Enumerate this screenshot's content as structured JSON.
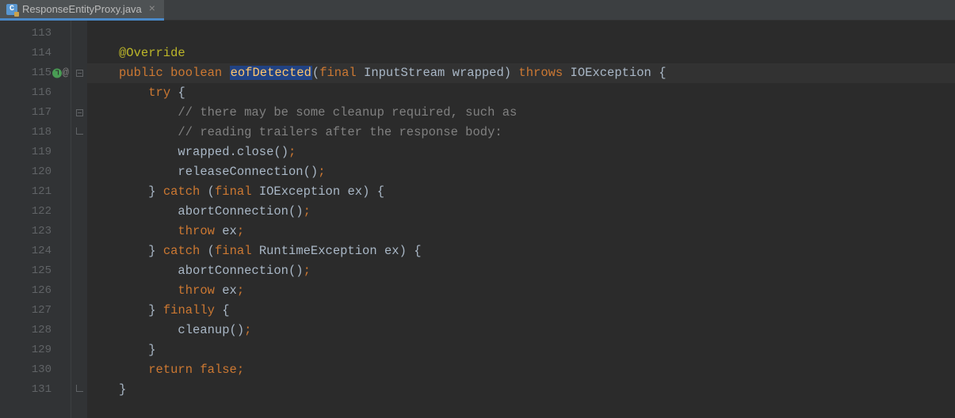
{
  "tab": {
    "icon_letter": "C",
    "filename": "ResponseEntityProxy.java",
    "close_symbol": "×"
  },
  "gutter": {
    "line_numbers": [
      "113",
      "114",
      "115",
      "116",
      "117",
      "118",
      "119",
      "120",
      "121",
      "122",
      "123",
      "124",
      "125",
      "126",
      "127",
      "128",
      "129",
      "130",
      "131"
    ],
    "impl_marker_line": "115",
    "at_symbol": "@"
  },
  "code": {
    "annotation_override": "@Override",
    "kw_public": "public",
    "kw_boolean": "boolean",
    "method_name": "eofDetected",
    "kw_final": "final",
    "type_inputstream": "InputStream",
    "var_wrapped": "wrapped",
    "kw_throws": "throws",
    "type_ioexception": "IOException",
    "brace_open": "{",
    "brace_close": "}",
    "kw_try": "try",
    "comment1": "// there may be some cleanup required, such as",
    "comment2": "// reading trailers after the response body:",
    "call_wrapped_close": "wrapped.close",
    "call_release": "releaseConnection",
    "kw_catch": "catch",
    "type_runtime_exception": "RuntimeException",
    "var_ex": "ex",
    "call_abort": "abortConnection",
    "kw_throw": "throw",
    "kw_finally": "finally",
    "call_cleanup": "cleanup",
    "kw_return": "return",
    "kw_false": "false",
    "paren_open": "(",
    "paren_close": ")",
    "semi": ";",
    "dot": "."
  }
}
